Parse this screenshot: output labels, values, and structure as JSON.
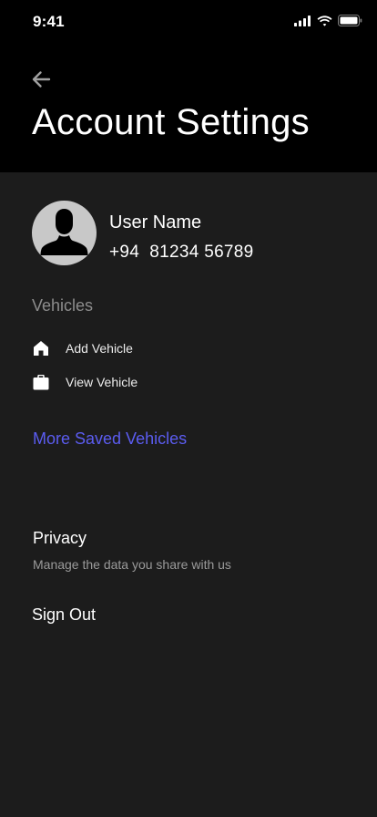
{
  "status_bar": {
    "time": "9:41",
    "icons": [
      "cellular-signal-icon",
      "wifi-icon",
      "battery-icon"
    ]
  },
  "header": {
    "back_icon": "arrow-left-icon",
    "title": "Account Settings"
  },
  "profile": {
    "avatar_icon": "user-silhouette-icon",
    "name": "User Name",
    "phone": "+94  81234 56789"
  },
  "vehicles": {
    "section_title": "Vehicles",
    "items": [
      {
        "icon": "home-icon",
        "label": "Add Vehicle"
      },
      {
        "icon": "briefcase-icon",
        "label": "View Vehicle"
      }
    ],
    "more_link": "More Saved Vehicles"
  },
  "privacy": {
    "title": "Privacy",
    "subtitle": "Manage the data you share with us"
  },
  "sign_out": {
    "label": "Sign Out"
  },
  "colors": {
    "background": "#1c1c1c",
    "header_background": "#000000",
    "link": "#5b5cf0",
    "muted_text": "#8c8c8c"
  }
}
